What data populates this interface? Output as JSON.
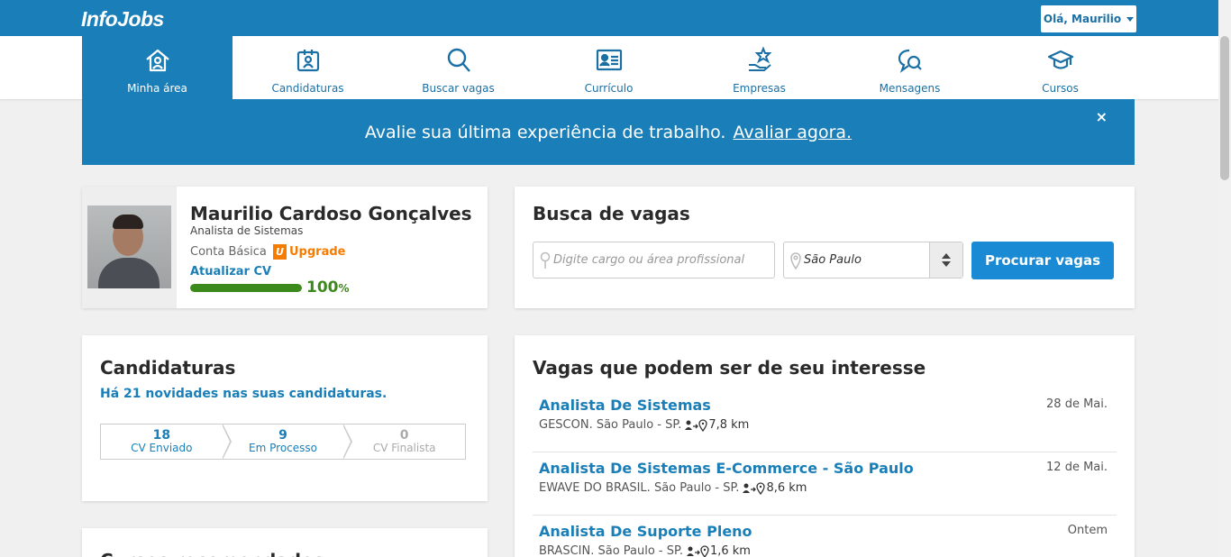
{
  "header": {
    "logo": "InfoJobs",
    "user_greeting": "Olá, Maurilio"
  },
  "nav": {
    "items": [
      {
        "label": "Minha área",
        "icon": "home-icon",
        "active": true
      },
      {
        "label": "Candidaturas",
        "icon": "badge-icon"
      },
      {
        "label": "Buscar vagas",
        "icon": "search-icon"
      },
      {
        "label": "Currículo",
        "icon": "id-card-icon"
      },
      {
        "label": "Empresas",
        "icon": "star-hand-icon"
      },
      {
        "label": "Mensagens",
        "icon": "chat-search-icon"
      },
      {
        "label": "Cursos",
        "icon": "graduation-cap-icon"
      }
    ]
  },
  "banner": {
    "text": "Avalie sua última experiência de trabalho.",
    "link": "Avaliar agora.",
    "close": "×"
  },
  "profile": {
    "name": "Maurilio Cardoso Gonçalves",
    "role": "Analista de Sistemas",
    "plan": "Conta Básica",
    "upgrade": "Upgrade",
    "update_cv": "Atualizar CV",
    "completion_value": "100",
    "completion_unit": "%",
    "completion": 100
  },
  "search": {
    "title": "Busca de vagas",
    "cargo_placeholder": "Digite cargo ou área profissional",
    "location": "São Paulo",
    "button": "Procurar vagas"
  },
  "applications": {
    "title": "Candidaturas",
    "news": "Há 21 novidades nas suas candidaturas.",
    "steps": [
      {
        "count": "18",
        "label": "CV Enviado"
      },
      {
        "count": "9",
        "label": "Em Processo"
      },
      {
        "count": "0",
        "label": "CV Finalista"
      }
    ]
  },
  "courses": {
    "title": "Cursos recomendados"
  },
  "jobs": {
    "title": "Vagas que podem ser de seu interesse",
    "items": [
      {
        "title": "Analista De Sistemas",
        "company": "GESCON. São Paulo - SP.",
        "distance": "7,8 km",
        "date": "28 de Mai."
      },
      {
        "title": "Analista De Sistemas E-Commerce - São Paulo",
        "company": "EWAVE DO BRASIL. São Paulo - SP.",
        "distance": "8,6 km",
        "date": "12 de Mai."
      },
      {
        "title": "Analista De Suporte Pleno",
        "company": "BRASCIN. São Paulo - SP.",
        "distance": "1,6 km",
        "date": "Ontem"
      }
    ]
  },
  "colors": {
    "brand": "#1a7fb8",
    "accent": "#f57c00",
    "success": "#3d8a1c",
    "button": "#1a8ad4"
  }
}
